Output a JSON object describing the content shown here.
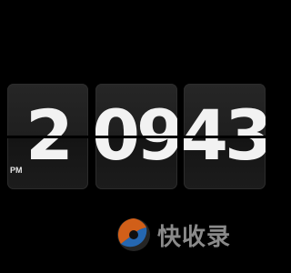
{
  "clock": {
    "hour": "2",
    "minute": "09",
    "second": "43",
    "meridiem": "PM"
  },
  "watermark": {
    "text": "快收录",
    "logo_icon": "kuaishoulu-logo-icon"
  },
  "colors": {
    "background": "#000000",
    "tile": "#1f1f1f",
    "digit": "#f2f2f2",
    "watermark_orange": "#e86a1c",
    "watermark_blue": "#2a7bd6"
  }
}
